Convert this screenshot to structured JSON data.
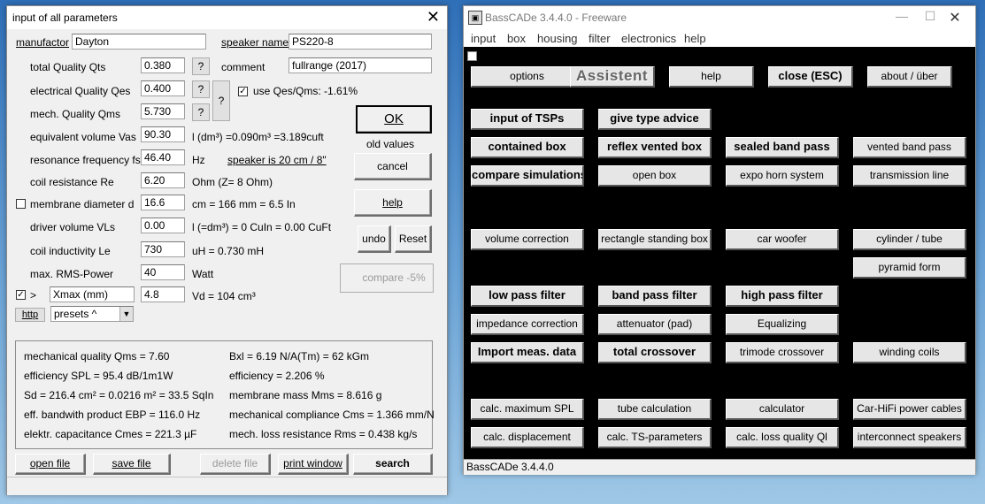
{
  "dialog": {
    "title": "input of all parameters",
    "manufactor_label": "manufactor",
    "manufactor_value": "Dayton",
    "speaker_name_label": "speaker name",
    "speaker_name_value": "PS220-8",
    "comment_label": "comment",
    "comment_value": "fullrange (2017)",
    "params": {
      "qts": {
        "label": "total Quality Qts",
        "value": "0.380"
      },
      "qes": {
        "label": "electrical Quality Qes",
        "value": "0.400"
      },
      "qms": {
        "label": "mech. Quality Qms",
        "value": "5.730"
      },
      "vas": {
        "label": "equivalent volume Vas",
        "value": "90.30",
        "unit": "l (dm³) =0.090m³ =3.189cuft"
      },
      "fs": {
        "label": "resonance frequency fs",
        "value": "46.40",
        "unit": "Hz"
      },
      "re": {
        "label": "coil resistance Re",
        "value": "6.20",
        "unit": "Ohm (Z= 8 Ohm)"
      },
      "d": {
        "label": "membrane diameter d",
        "value": "16.6",
        "unit": "cm = 166 mm = 6.5 In"
      },
      "vls": {
        "label": "driver volume VLs",
        "value": "0.00",
        "unit": "l (=dm³) = 0 CuIn = 0.00 CuFt"
      },
      "le": {
        "label": "coil inductivity Le",
        "value": "730",
        "unit": "uH = 0.730 mH"
      },
      "rms": {
        "label": "max. RMS-Power",
        "value": "40",
        "unit": "Watt"
      }
    },
    "speaker_size_link": "speaker is 20 cm / 8\"",
    "question_mark": "?",
    "use_qes_qms": "use Qes/Qms: -1.61%",
    "arrow": ">",
    "xmax_label": "Xmax (mm)",
    "xmax_value": "4.8",
    "vd_text": "Vd = 104 cm³",
    "http_button": "http",
    "presets_value": "presets ^",
    "ok_button": "OK",
    "old_values_label": "old values",
    "cancel_button": "cancel",
    "help_button": "help",
    "undo_button": "undo",
    "reset_button": "Reset",
    "compare_button": "compare -5%",
    "results": {
      "qms": "mechanical quality Qms = 7.60",
      "spl": "efficiency SPL = 95.4 dB/1m1W",
      "sd": "Sd = 216.4 cm² = 0.0216 m² = 33.5 SqIn",
      "ebp": "eff. bandwith product EBP = 116.0 Hz",
      "cmes": "elektr. capacitance Cmes = 221.3 µF",
      "bxl": "Bxl = 6.19 N/A(Tm) = 62 kGm",
      "eff": "efficiency = 2.206 %",
      "mms": "membrane mass Mms = 8.616 g",
      "cms": "mechanical compliance Cms = 1.366 mm/N",
      "rms": "mech. loss resistance Rms = 0.438 kg/s"
    },
    "bottom_buttons": {
      "open": "open file",
      "save": "save file",
      "delete": "delete file",
      "print": "print window",
      "search": "search speaker"
    }
  },
  "window": {
    "title": "BassCADe 3.4.4.0 - Freeware",
    "menu": [
      "input",
      "box",
      "housing",
      "filter",
      "electronics",
      "help"
    ],
    "buttons": {
      "options": "options",
      "assistent": "Assistent",
      "help": "help",
      "close": "close (ESC)",
      "about": "about / über",
      "input_tsps": "input of TSPs",
      "type_advice": "give type advice",
      "contained_box": "contained box",
      "reflex_box": "reflex vented box",
      "sealed_band_pass": "sealed band pass",
      "vented_band_pass": "vented band pass",
      "compare_sim": "compare simulations",
      "open_box": "open box",
      "expo_horn": "expo horn system",
      "transmission_line": "transmission line",
      "volume_correction": "volume correction",
      "rect_box": "rectangle standing box",
      "car_woofer": "car woofer",
      "cylinder": "cylinder / tube",
      "pyramid": "pyramid form",
      "low_pass": "low pass filter",
      "band_pass": "band pass filter",
      "high_pass": "high pass filter",
      "impedance": "impedance correction",
      "attenuator": "attenuator (pad)",
      "equalizing": "Equalizing",
      "import_meas": "Import meas. data",
      "total_crossover": "total crossover",
      "trimode": "trimode crossover",
      "winding": "winding coils",
      "max_spl": "calc. maximum SPL",
      "tube_calc": "tube calculation",
      "calculator": "calculator",
      "carhifi": "Car-HiFi power cables",
      "displacement": "calc. displacement",
      "ts_params": "calc. TS-parameters",
      "loss_quality": "calc. loss quality Ql",
      "interconnect": "interconnect speakers"
    },
    "status": "BassCADe 3.4.4.0"
  }
}
